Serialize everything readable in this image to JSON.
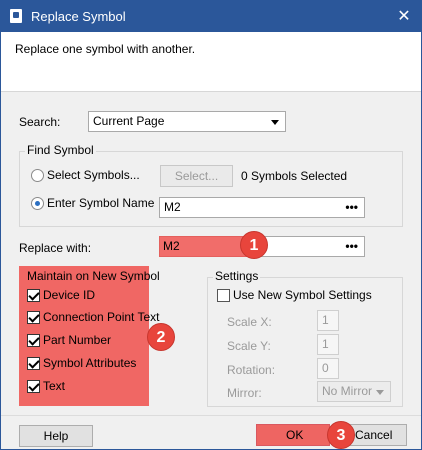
{
  "window": {
    "title": "Replace Symbol",
    "close_glyph": "✕"
  },
  "header": {
    "description": "Replace one symbol with another."
  },
  "search": {
    "label": "Search:",
    "value": "Current Page"
  },
  "find_symbol": {
    "title": "Find Symbol",
    "select_symbols_label": "Select Symbols...",
    "select_button": "Select...",
    "selected_count": "0 Symbols Selected",
    "enter_symbol_label": "Enter Symbol Name",
    "symbol_name_value": "M2",
    "ellipsis": "•••",
    "selected_option": "enter_symbol_name"
  },
  "replace_with": {
    "label": "Replace with:",
    "value": "M2",
    "ellipsis": "•••"
  },
  "maintain": {
    "title": "Maintain on New Symbol",
    "items": [
      {
        "label": "Device ID",
        "checked": true
      },
      {
        "label": "Connection Point Text",
        "checked": true
      },
      {
        "label": "Part Number",
        "checked": true
      },
      {
        "label": "Symbol Attributes",
        "checked": true
      },
      {
        "label": "Text",
        "checked": true
      }
    ]
  },
  "settings": {
    "title": "Settings",
    "use_new_label": "Use New Symbol Settings",
    "use_new_checked": false,
    "scale_x_label": "Scale X:",
    "scale_x_value": "1",
    "scale_y_label": "Scale Y:",
    "scale_y_value": "1",
    "rotation_label": "Rotation:",
    "rotation_value": "0",
    "mirror_label": "Mirror:",
    "mirror_value": "No Mirror"
  },
  "footer": {
    "help": "Help",
    "ok": "OK",
    "cancel": "Cancel"
  },
  "annotations": {
    "step1": "1",
    "step2": "2",
    "step3": "3"
  },
  "colors": {
    "titlebar": "#2b579a",
    "highlight": "#ef5350",
    "badge": "#e8453c"
  }
}
